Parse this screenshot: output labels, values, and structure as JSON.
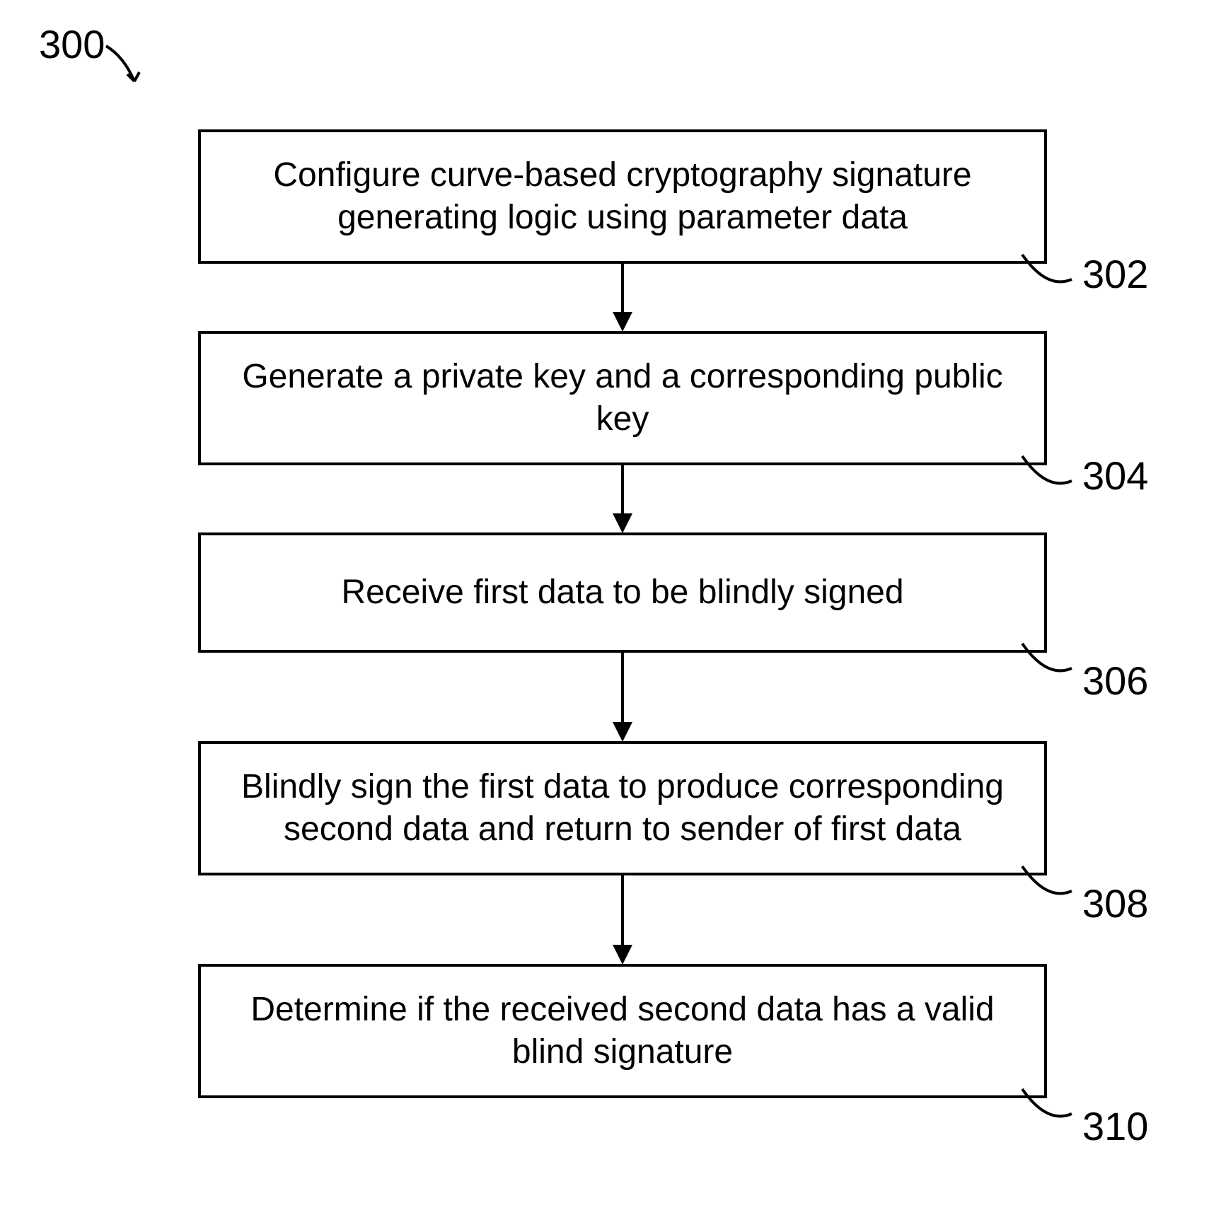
{
  "diagram": {
    "title_ref": "300",
    "steps": [
      {
        "id": "302",
        "text": "Configure curve-based cryptography signature generating logic using parameter data"
      },
      {
        "id": "304",
        "text": "Generate a private key and a corresponding public key"
      },
      {
        "id": "306",
        "text": "Receive first data to be blindly signed"
      },
      {
        "id": "308",
        "text": "Blindly sign the first data to produce corresponding second data and return to sender of first data"
      },
      {
        "id": "310",
        "text": "Determine if the received second data  has a valid blind signature"
      }
    ]
  }
}
